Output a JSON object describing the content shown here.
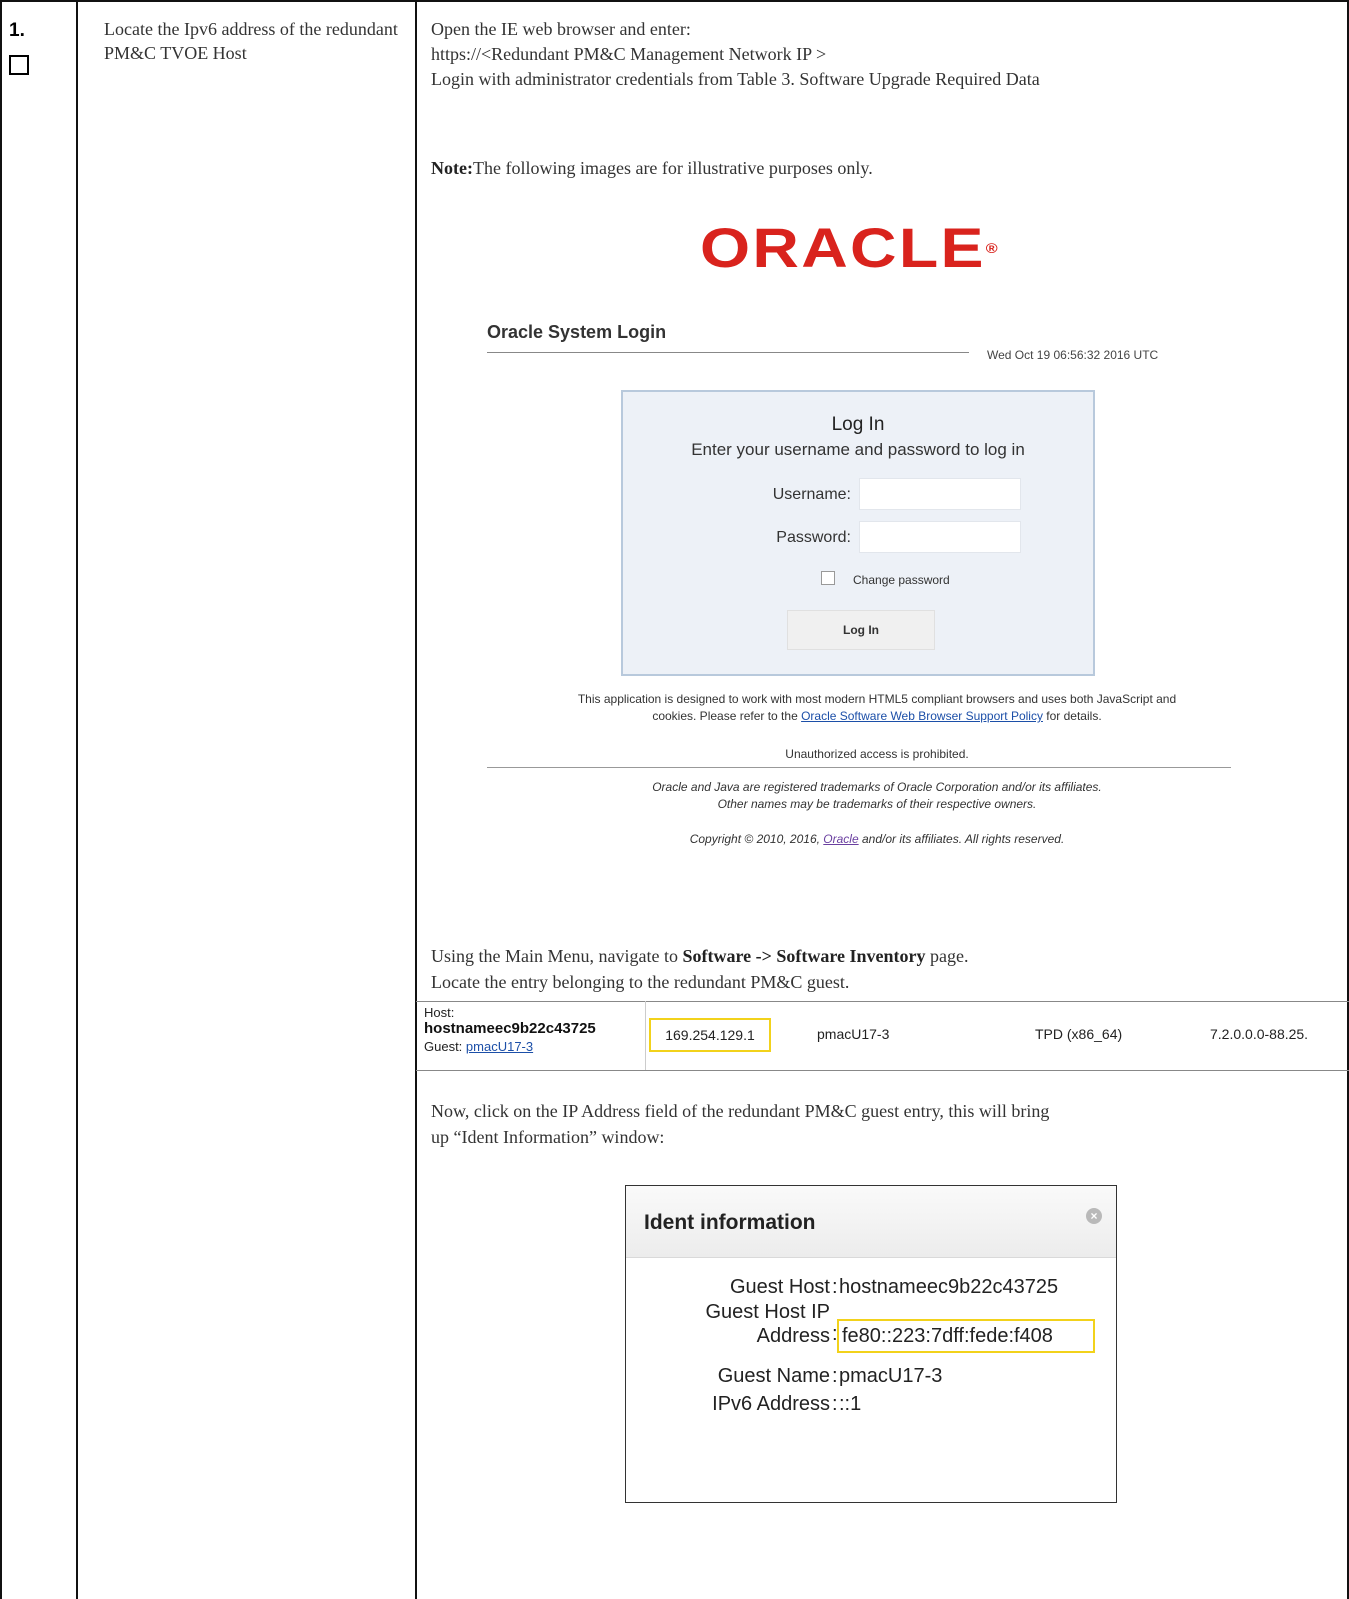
{
  "step": {
    "number": "1.",
    "description": "Locate the Ipv6 address of the redundant PM&C TVOE Host"
  },
  "instructions": {
    "line1": "Open the IE web browser and enter:",
    "line2": "https://<Redundant PM&C Management Network IP >",
    "line3": "Login with administrator credentials from Table 3. Software Upgrade Required Data",
    "note_label": "Note:",
    "note_text": "The following images are for illustrative purposes only.",
    "nav_prefix": "Using the Main Menu, navigate to ",
    "nav_bold": "Software -> Software Inventory",
    "nav_suffix": " page.",
    "locate": "Locate the entry belonging to the redundant PM&C guest.",
    "click_line1": "Now, click on the IP Address field of the redundant PM&C guest entry, this will bring",
    "click_line2": "up “Ident Information” window:"
  },
  "login_screen": {
    "logo": "ORACLE",
    "logo_mark": "®",
    "title": "Oracle System Login",
    "datetime": "Wed Oct 19 06:56:32 2016 UTC",
    "box_title": "Log In",
    "box_subtitle": "Enter your username and password to log in",
    "username_label": "Username:",
    "password_label": "Password:",
    "change_password_label": "Change password",
    "login_button": "Log In",
    "info_line1": "This application is designed to work with most modern HTML5 compliant browsers and uses both JavaScript and",
    "info_line2_prefix": "cookies. Please refer to the ",
    "info_link": "Oracle Software Web Browser Support Policy",
    "info_line2_suffix": " for details.",
    "unauthorized": "Unauthorized access is prohibited.",
    "trademark1": "Oracle and Java are registered trademarks of Oracle Corporation and/or its affiliates.",
    "trademark2": "Other names may be trademarks of their respective owners.",
    "copyright_prefix": "Copyright © 2010, 2016, ",
    "copyright_link": "Oracle",
    "copyright_suffix": " and/or its affiliates. All rights reserved."
  },
  "inventory_row": {
    "host_label": "Host:",
    "host": "hostnameec9b22c43725",
    "guest_label": "Guest: ",
    "guest_link": "pmacU17-3",
    "ip": "169.254.129.1",
    "name": "pmacU17-3",
    "platform": "TPD (x86_64)",
    "version": "7.2.0.0.0-88.25."
  },
  "ident_dialog": {
    "title": "Ident information",
    "close_glyph": "×",
    "guest_host_label": "Guest Host",
    "guest_host_value": "hostnameec9b22c43725",
    "guest_host_ip_label_1": "Guest Host IP",
    "guest_host_ip_label_2": "Address",
    "guest_host_ip_value": "fe80::223:7dff:fede:f408",
    "guest_name_label": "Guest Name",
    "guest_name_value": "pmacU17-3",
    "ipv6_label": "IPv6 Address",
    "ipv6_value": "::1",
    "colon": ":"
  }
}
